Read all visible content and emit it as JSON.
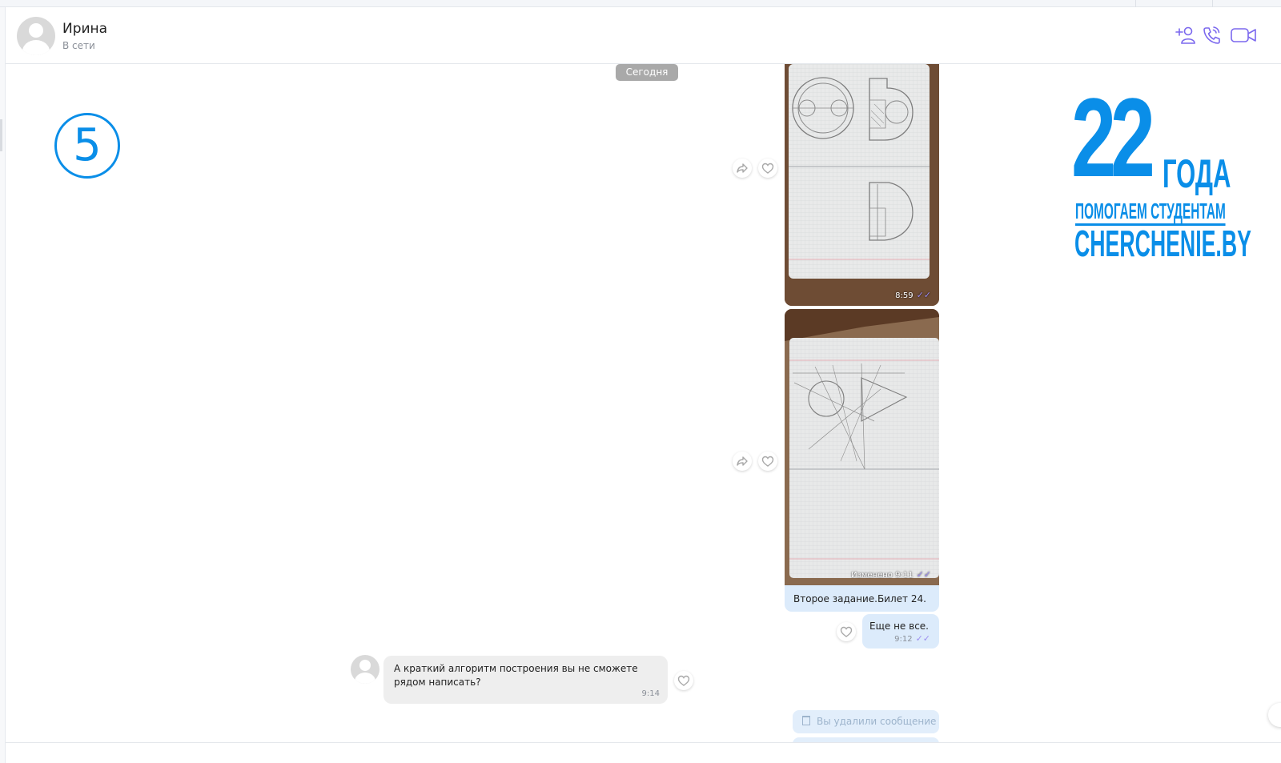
{
  "header": {
    "contact_name": "Ирина",
    "contact_status": "В сети",
    "icons": [
      "add-user-icon",
      "phone-icon",
      "video-call-icon"
    ]
  },
  "chat": {
    "date_separator": "Сегодня",
    "messages": [
      {
        "type": "photo",
        "direction": "outgoing",
        "time": "8:59"
      },
      {
        "type": "photo",
        "direction": "outgoing",
        "time": "Изменено 9:11",
        "caption": "Второе задание.Билет 24."
      },
      {
        "type": "text",
        "direction": "outgoing",
        "text": "Еще не все.",
        "time": "9:12"
      },
      {
        "type": "text",
        "direction": "incoming",
        "text": "А краткий алгоритм построения вы не сможете рядом написать?",
        "time": "9:14"
      },
      {
        "type": "deleted",
        "direction": "outgoing",
        "text": "Вы удалили сообщение"
      }
    ],
    "read_ticks": "✓✓"
  },
  "overlay": {
    "step_number": "5",
    "brand_number": "22",
    "brand_years": "ГОДА",
    "brand_tagline": "ПОМОГАЕМ СТУДЕНТАМ",
    "brand_site": "CHERCHENIE.BY"
  },
  "colors": {
    "accent": "#7b68ee",
    "brand_blue": "#0a8ee8",
    "outgoing_bubble": "#dcebfb",
    "incoming_bubble": "#eeeeee"
  }
}
